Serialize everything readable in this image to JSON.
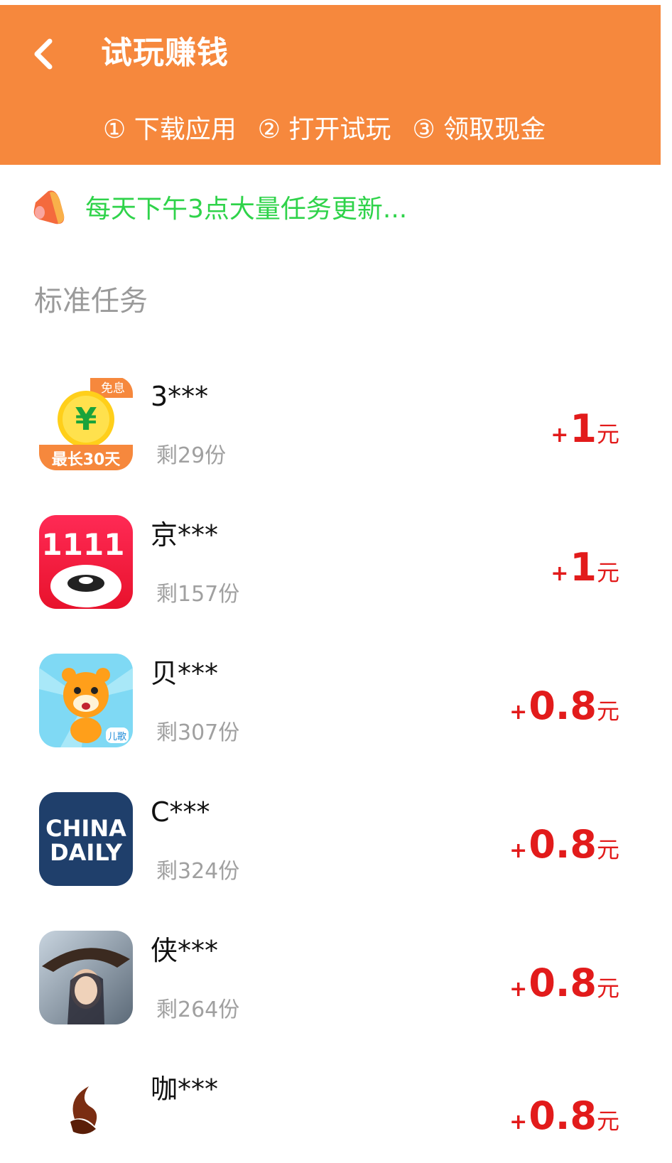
{
  "header": {
    "title": "试玩赚钱",
    "steps": [
      "① 下载应用",
      "② 打开试玩",
      "③ 领取现金"
    ],
    "background_color": "#f6883d"
  },
  "notice": {
    "text": "每天下午3点大量任务更新...",
    "text_color": "#2fd34a"
  },
  "section": {
    "title": "标准任务"
  },
  "tasks": [
    {
      "name": "3***",
      "remaining": "剩29份",
      "reward_plus": "+",
      "reward_amount": "1",
      "reward_unit": "元",
      "icon": "yuan-coin-app-icon",
      "icon_badge_top": "免息",
      "icon_badge_bottom": "最长30天"
    },
    {
      "name": "京***",
      "remaining": "剩157份",
      "reward_plus": "+",
      "reward_amount": "1",
      "reward_unit": "元",
      "icon": "jd-1111-app-icon",
      "icon_badge_top": "1111"
    },
    {
      "name": "贝***",
      "remaining": "剩307份",
      "reward_plus": "+",
      "reward_amount": "0.8",
      "reward_unit": "元",
      "icon": "tiger-app-icon",
      "icon_badge_top": "儿歌"
    },
    {
      "name": "C***",
      "remaining": "剩324份",
      "reward_plus": "+",
      "reward_amount": "0.8",
      "reward_unit": "元",
      "icon": "china-daily-app-icon",
      "icon_badge_top": "CHINA",
      "icon_badge_bottom": "DAILY"
    },
    {
      "name": "侠***",
      "remaining": "剩264份",
      "reward_plus": "+",
      "reward_amount": "0.8",
      "reward_unit": "元",
      "icon": "swordsman-game-app-icon"
    },
    {
      "name": "咖***",
      "remaining": "",
      "reward_plus": "+",
      "reward_amount": "0.8",
      "reward_unit": "元",
      "icon": "coffee-app-icon"
    }
  ],
  "colors": {
    "reward": "#e21b1b",
    "muted": "#9a9a9a"
  }
}
